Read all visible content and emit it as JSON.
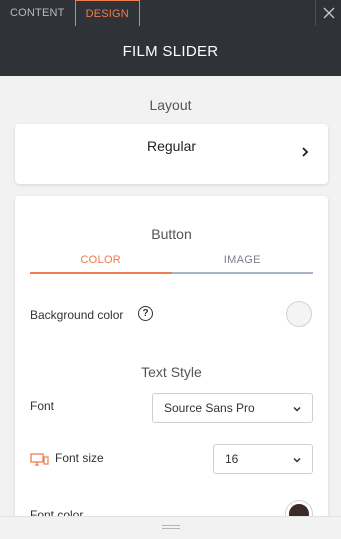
{
  "topbar": {
    "tabs": [
      {
        "label": "CONTENT",
        "active": false
      },
      {
        "label": "DESIGN",
        "active": true
      }
    ],
    "close_icon": "close-icon"
  },
  "title": "FILM SLIDER",
  "layout": {
    "section_title": "Layout",
    "value": "Regular",
    "chevron_icon": "chevron-right-icon"
  },
  "button": {
    "section_title": "Button",
    "tabs": [
      {
        "label": "COLOR",
        "active": true
      },
      {
        "label": "IMAGE",
        "active": false
      }
    ],
    "background_color_label": "Background color",
    "background_color": "#f4f4f4",
    "help_icon": "?",
    "text_style_title": "Text Style",
    "font_label": "Font",
    "font_value": "Source Sans Pro",
    "font_size_label": "Font size",
    "font_size_value": "16",
    "font_size_device_icon": "desktop-icon",
    "font_color_label": "Font color",
    "font_color": "#3a2b27"
  },
  "colors": {
    "accent": "#ee7c4d",
    "dark_bar": "#2f3237"
  }
}
